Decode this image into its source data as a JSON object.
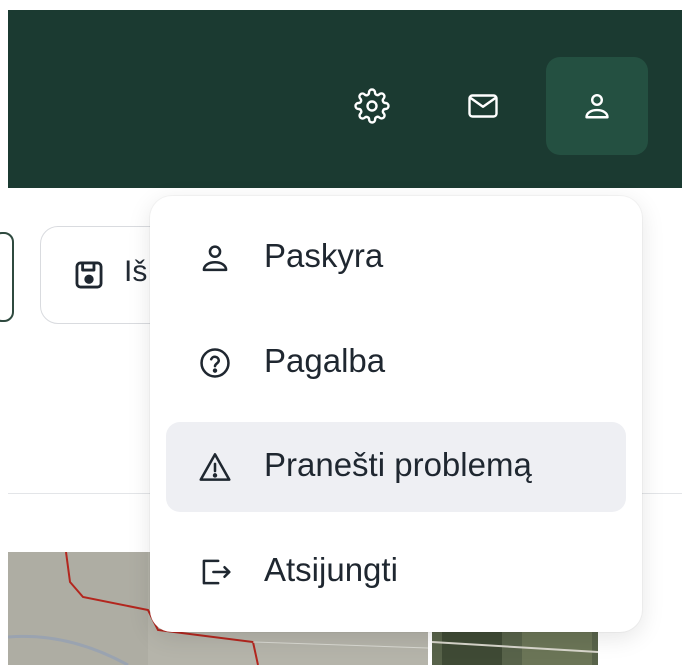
{
  "header": {
    "background_color": "#1b3a31",
    "active_button_color": "#245041",
    "buttons": [
      {
        "icon": "gear-icon"
      },
      {
        "icon": "mail-icon"
      },
      {
        "icon": "user-icon",
        "active": true
      }
    ]
  },
  "toolbar": {
    "save_label": "Iš",
    "save_icon": "floppy-disk-icon"
  },
  "user_menu": {
    "highlight_color": "#eeeff3",
    "items": [
      {
        "label": "Paskyra",
        "icon": "user-icon"
      },
      {
        "label": "Pagalba",
        "icon": "help-circle-icon"
      },
      {
        "label": "Pranešti problemą",
        "icon": "warning-triangle-icon",
        "highlighted": true
      },
      {
        "label": "Atsijungti",
        "icon": "logout-icon"
      }
    ]
  }
}
